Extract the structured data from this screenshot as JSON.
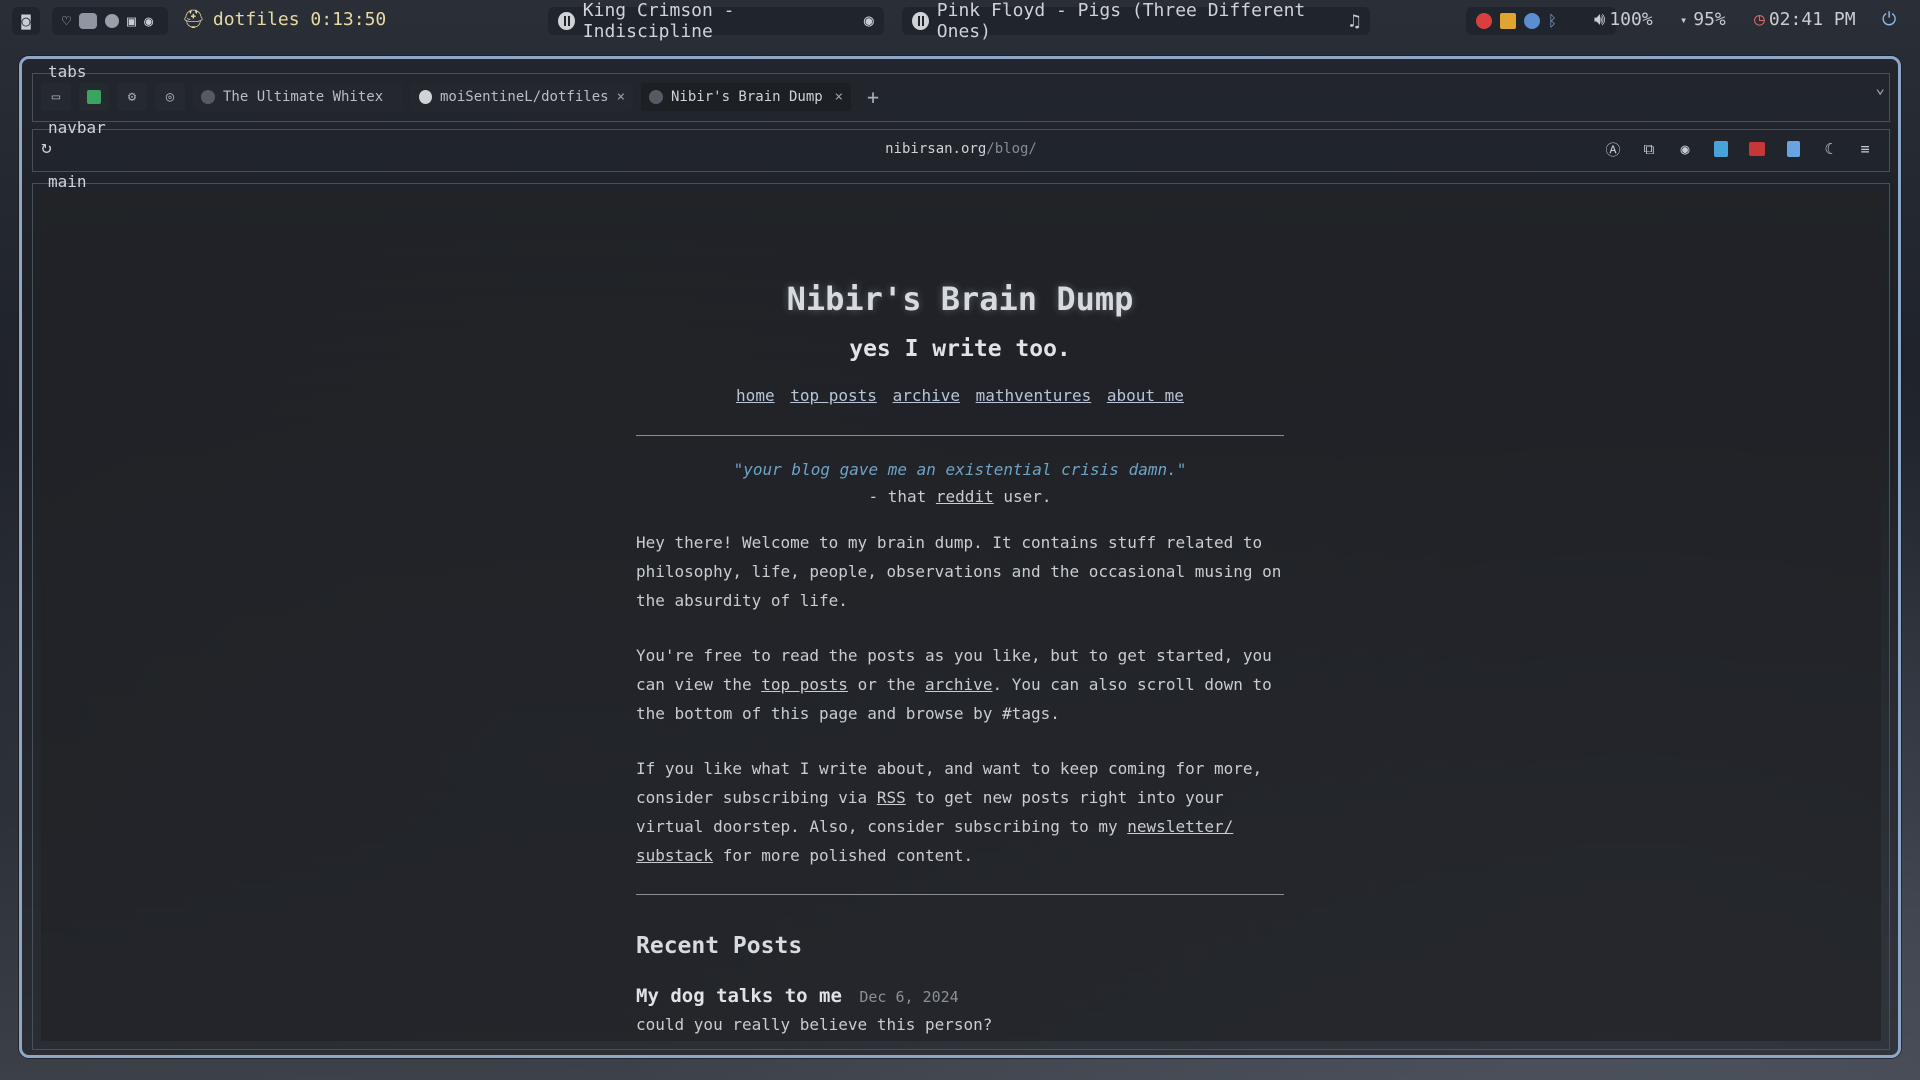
{
  "topbar": {
    "workspace_label": "dotfiles 0:13:50",
    "media1": "King Crimson - Indiscipline",
    "media2": "Pink Floyd - Pigs (Three Different Ones)",
    "volume": "100%",
    "battery": "95%",
    "clock": "02:41 PM"
  },
  "browser": {
    "tabs_label": "tabs",
    "navbar_label": "navbar",
    "main_label": "main",
    "tabs": [
      {
        "title": "The Ultimate Whitex",
        "close": "×"
      },
      {
        "title": "moiSentineL/dotfiles",
        "close": "×"
      },
      {
        "title": "Nibir's Brain Dump",
        "close": "×"
      }
    ],
    "add_tab": "+",
    "url_host": "nibirsan.org",
    "url_path": "/blog/"
  },
  "page": {
    "title": "Nibir's Brain Dump",
    "subtitle": "yes I write too.",
    "nav": [
      "home",
      "top posts",
      "archive",
      "mathventures",
      "about me"
    ],
    "quote": "\"your blog gave me an existential crisis damn.\"",
    "quote_by_prefix": "- that",
    "quote_by_link": "reddit",
    "quote_by_suffix": "user.",
    "p1": "Hey there! Welcome to my brain dump. It contains stuff related to philosophy, life, people, observations and the occasional musing on the absurdity of life.",
    "p2_a": "You're free to read the posts as you like, but to get started, you can view the",
    "p2_link1": "top posts",
    "p2_b": "or the",
    "p2_link2": "archive",
    "p2_c": ". You can also scroll down to the bottom of this page and browse by #tags.",
    "p3_a": "If you like what I write about, and want to keep coming for more, consider subscribing via",
    "p3_link1": "RSS",
    "p3_b": "to get new posts right into your virtual doorstep. Also, consider subscribing to my",
    "p3_link2": "newsletter/ substack",
    "p3_c": "for more polished content.",
    "recent_title": "Recent Posts",
    "posts": [
      {
        "title": "My dog talks to me",
        "date": "Dec 6, 2024",
        "desc": "could you really believe this person?"
      }
    ]
  },
  "colors": {
    "window_border": "#8fa7c6",
    "quote": "#6ea3c6",
    "workspace_label": "#e6d9a3"
  }
}
